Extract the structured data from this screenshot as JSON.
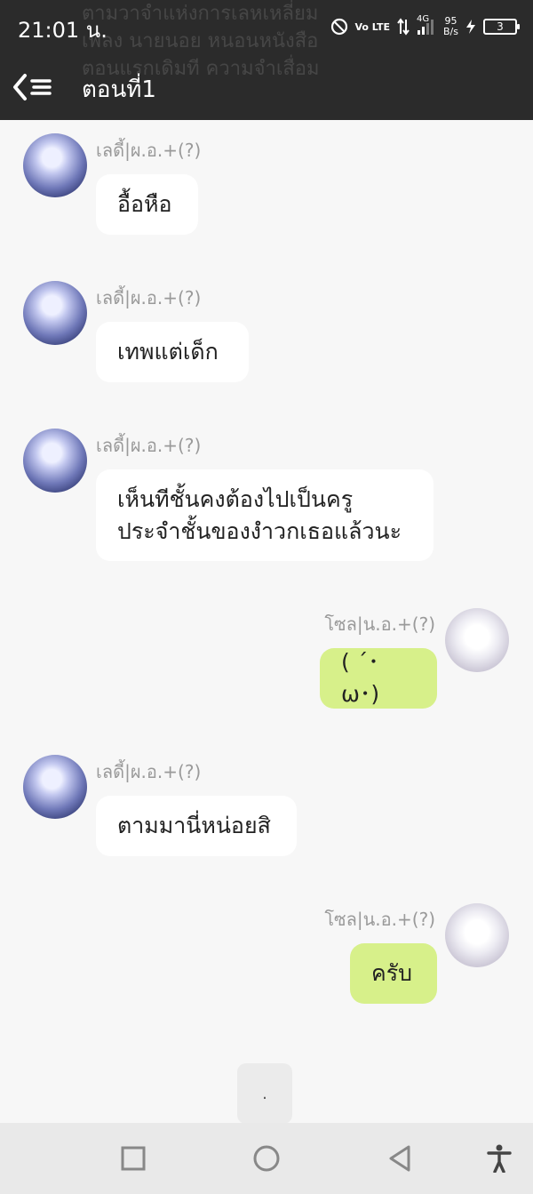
{
  "status_bar": {
    "time": "21:01 น.",
    "volte": "Vo LTE",
    "network": "4G",
    "speed_value": "95",
    "speed_unit": "B/s",
    "battery": "3"
  },
  "header": {
    "ghost_lines": [
      "ตามวาจำแห่งการเลหเหลี่ยม",
      "เพลง นายนอย หนอนหนังสือ",
      "ตอนแรกเดิมที ความจำเสื่อม"
    ],
    "title": "ตอนที่1"
  },
  "messages": [
    {
      "side": "left",
      "sender": "เลดี้|ผ.อ.+(?)",
      "text": "อื้อหือ"
    },
    {
      "side": "left",
      "sender": "เลดี้|ผ.อ.+(?)",
      "text": "เทพแต่เด็ก"
    },
    {
      "side": "left",
      "sender": "เลดี้|ผ.อ.+(?)",
      "text": "เห็นทีชั้นคงต้องไปเป็นครู\nประจำชั้นของงำวกเธอแล้วนะ"
    },
    {
      "side": "right",
      "sender": "โซล|น.อ.+(?)",
      "text": "( ´･ω･)"
    },
    {
      "side": "left",
      "sender": "เลดี้|ผ.อ.+(?)",
      "text": "ตามมานี่หน่อยสิ"
    },
    {
      "side": "right",
      "sender": "โซล|น.อ.+(?)",
      "text": "ครับ"
    }
  ],
  "more_button_label": ".",
  "nav": {
    "icons": [
      "recents-square-icon",
      "home-circle-icon",
      "back-triangle-icon",
      "accessibility-icon"
    ]
  },
  "colors": {
    "header_bg": "#2b2b2b",
    "chat_bg": "#f7f7f7",
    "bubble_left": "#ffffff",
    "bubble_right": "#d7f08a"
  }
}
